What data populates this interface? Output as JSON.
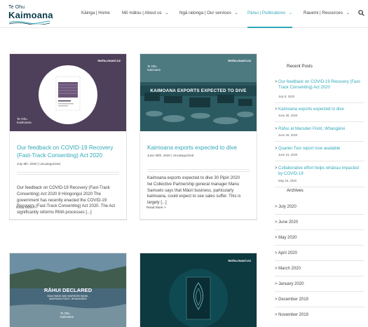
{
  "site": {
    "logo_line1": "Te Ohu",
    "logo_line2": "Kaimoana"
  },
  "nav": [
    {
      "label": "Kāinga | Home",
      "has_dropdown": false,
      "active": false
    },
    {
      "label": "Mō mātou | About us",
      "has_dropdown": true,
      "active": false
    },
    {
      "label": "Ngā ratonga | Our services",
      "has_dropdown": true,
      "active": false
    },
    {
      "label": "Pānui | Publications",
      "has_dropdown": true,
      "active": true
    },
    {
      "label": "Rauemi | Resources",
      "has_dropdown": true,
      "active": false
    }
  ],
  "nav_dropdown_glyph": "⌄",
  "colors": {
    "accent": "#2fa8b8",
    "brand_dark": "#0b3a4a",
    "card1_bg": "#4e3f5a",
    "card4_bg": "#0d3940"
  },
  "posts": [
    {
      "title": "Our feedback on COVID-19 Recovery (Fast-Track Consenting) Act 2020",
      "meta": "July 8th, 2020  |  Uncategorized",
      "excerpt": "Our feedback on COVID-19 Recovery (Fast-Track Consenting) Act 2020 8 Hōngongoi 2020 The government has recently enacted the COVID-19 Recovery (Fast-Track Consenting) Act 2020. The Act significantly reforms RMA processes [...]",
      "read_more": "Read More >",
      "image_url_text": "teohu.maori.nz",
      "image_logo": "Te Ohu\nKaimoana"
    },
    {
      "title": "Kaimoana exports expected to dive",
      "meta": "June 30th, 2020  |  Uncategorized",
      "excerpt": "Kaimoana exports expected to dive 30 Pipiri 2020        Iwi Collective Partnership general manager Manu Samuels says that Māori business, particularly kaimoana, could expect to see sales suffer. This is largely [...]",
      "read_more": "Read More >",
      "image_url_text": "teohu.maori.nz",
      "image_headline": "KAIMOANA EXPORTS EXPECTED TO DIVE",
      "image_logo": "Te Ohu\nKaimoana"
    },
    {
      "image_headline": "RĀHUI DECLARED",
      "image_subline": "MAUI BANK AND MARSDEN BANK,\nMARSDEN POINT, WHANGĀREI",
      "image_logo": "Te Ohu\nKaimoana"
    },
    {
      "image_url_text": "teohu.maori.nz"
    }
  ],
  "sidebar": {
    "recent_heading": "Recent Posts",
    "recent_posts": [
      {
        "title": "Our feedback on COVID-19 Recovery (Fast-Track Consenting) Act 2020",
        "date": "July 8, 2020"
      },
      {
        "title": "Kaimoana exports expected to dive",
        "date": "June 30, 2020"
      },
      {
        "title": "Rāhui at Marsden Point, Whangārei",
        "date": "June 29, 2020"
      },
      {
        "title": "Quarter Two report now available",
        "date": "June 24, 2020"
      },
      {
        "title": "Collaborative effort helps whānau impacted by COVID-19",
        "date": "May 26, 2020"
      }
    ],
    "archives_heading": "Archives",
    "archives": [
      "> July 2020",
      "> June 2020",
      "> May 2020",
      "> April 2020",
      "> March 2020",
      "> January 2020",
      "> December 2019",
      "> November 2019"
    ]
  },
  "glyphs": {
    "chevron_right": ">"
  }
}
